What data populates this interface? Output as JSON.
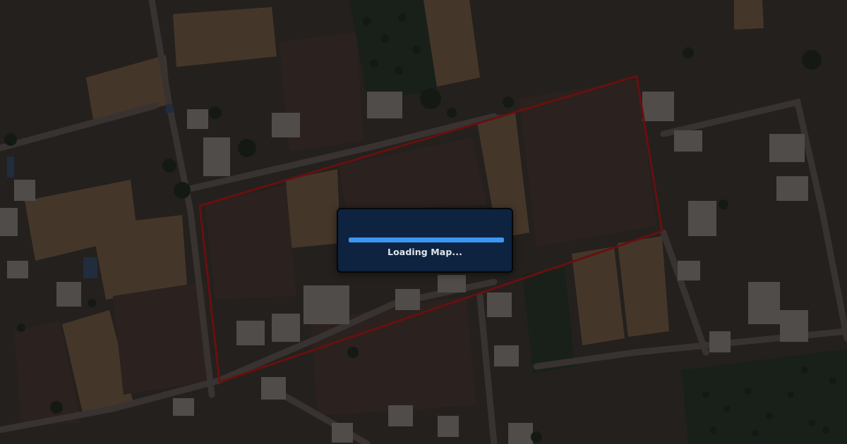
{
  "map": {
    "type": "satellite",
    "overlay": "dimmed",
    "boundary": {
      "shape": "polygon",
      "color": "#8b1414"
    }
  },
  "loader": {
    "text": "Loading Map...",
    "progress": 1.0,
    "box_color": "#0d2340",
    "bar_color": "#3b97f3",
    "text_color": "#dfe6ef"
  }
}
